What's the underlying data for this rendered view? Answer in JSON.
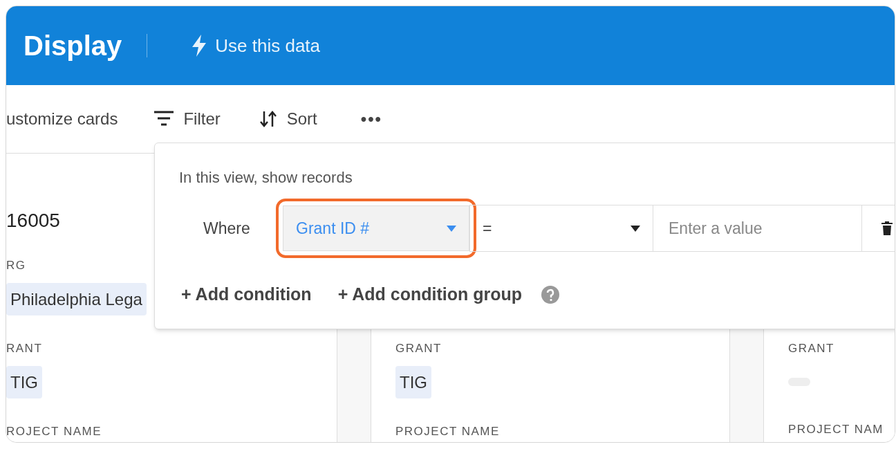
{
  "header": {
    "title": "Display",
    "action": "Use this data"
  },
  "toolbar": {
    "items": [
      {
        "kind": "text",
        "label": "ustomize cards"
      },
      {
        "kind": "filter",
        "label": "Filter"
      },
      {
        "kind": "sort",
        "label": "Sort"
      },
      {
        "kind": "more",
        "label": "•••"
      }
    ]
  },
  "cards": [
    {
      "title": "16005",
      "fields": [
        {
          "label": "RG",
          "kind": "tag",
          "value": "Philadelphia Lega"
        },
        {
          "label": "RANT",
          "kind": "tag",
          "value": "TIG"
        },
        {
          "label": "ROJECT NAME",
          "kind": "text"
        }
      ]
    },
    {
      "fields": [
        {
          "label": "GRANT",
          "kind": "tag",
          "value": "TIG"
        },
        {
          "label": "PROJECT NAME",
          "kind": "text"
        }
      ]
    },
    {
      "fields": [
        {
          "label": "GRANT",
          "kind": "empty_tag"
        },
        {
          "label": "PROJECT NAM",
          "kind": "text"
        }
      ]
    }
  ],
  "filter_popover": {
    "heading": "In this view, show records",
    "where_label": "Where",
    "field_select": {
      "value": "Grant ID #",
      "highlighted": true
    },
    "operator_select": {
      "value": "="
    },
    "value_input": {
      "placeholder": "Enter a value"
    },
    "actions": [
      "+ Add condition",
      "+ Add condition group"
    ]
  }
}
